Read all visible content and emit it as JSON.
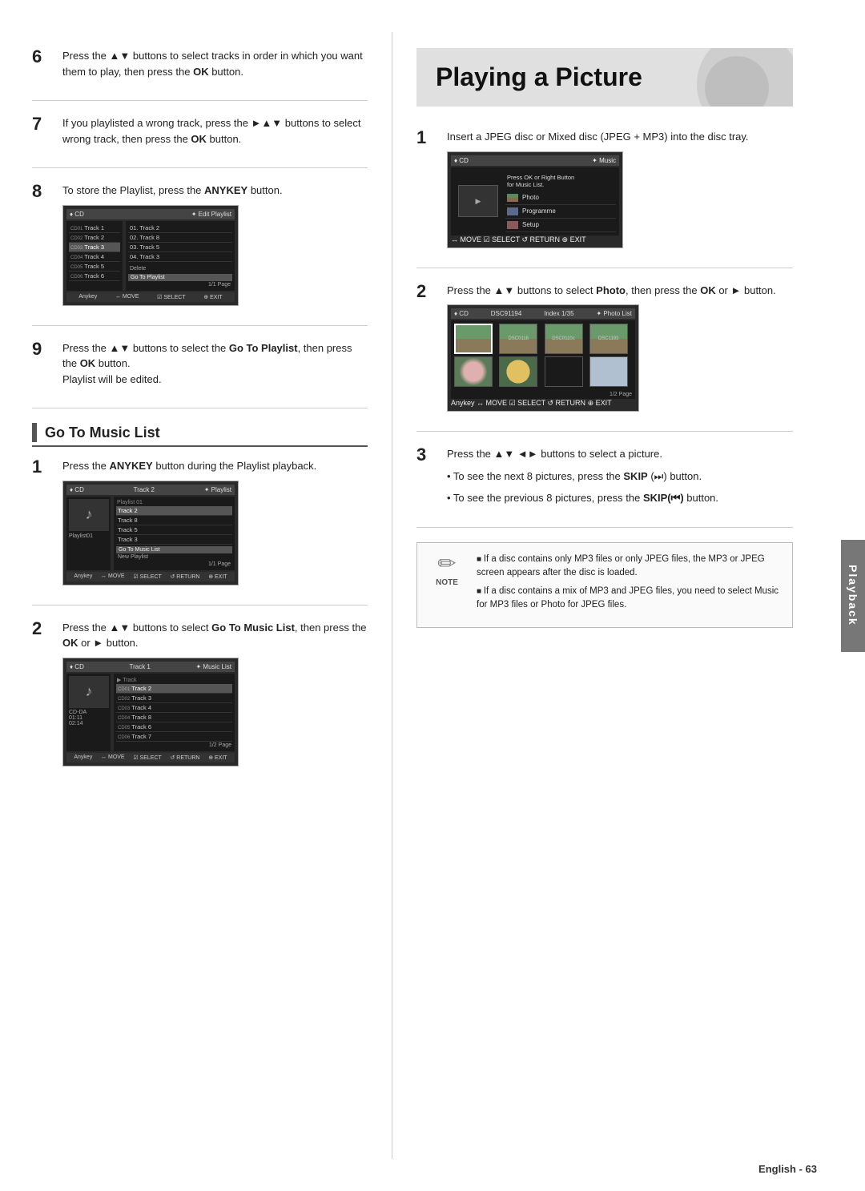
{
  "page": {
    "title": "Playing a Picture",
    "footer": "English - 63",
    "side_tab": "Playback"
  },
  "left_column": {
    "steps": [
      {
        "number": "6",
        "text": "Press the ▲▼ buttons to select tracks in order in which you want them to play, then press the ",
        "bold": "OK",
        "text_after": " button."
      },
      {
        "number": "7",
        "text": "If you playlisted a wrong track, press the ►▲▼ buttons to select wrong track, then press the ",
        "bold": "OK",
        "text_after": " button."
      },
      {
        "number": "8",
        "text": "To store the Playlist, press the ",
        "bold": "ANYKEY",
        "text_after": " button."
      },
      {
        "number": "9",
        "text_before": "Press the ▲▼ buttons to select the ",
        "bold1": "Go To Playlist",
        "text_middle": ", then press the ",
        "bold2": "OK",
        "text_after": " button.\nPlaylist will be edited."
      }
    ],
    "subsection": {
      "title": "Go To Music List",
      "steps": [
        {
          "number": "1",
          "text": "Press the ",
          "bold": "ANYKEY",
          "text_after": " button during the Playlist playback."
        },
        {
          "number": "2",
          "text": "Press the ▲▼ buttons to select ",
          "bold": "Go To Music List",
          "text_after": ", then press the ",
          "bold2": "OK",
          "text_after2": " or ► button."
        }
      ]
    },
    "screen_edit_playlist": {
      "top_left": "♦ CD",
      "top_title": "✦ Edit Playlist",
      "left_tracks": [
        "Track 1",
        "Track 2",
        "Track 3",
        "Track 4",
        "Track 5",
        "Track 6"
      ],
      "right_tracks": [
        "01. Track 2",
        "02. Track 8",
        "03. Track 5",
        "04. Track 3"
      ],
      "delete_label": "Delete",
      "go_to": "Go To Playlist",
      "bottom": "Anykey ↔ MOVE  ☑ SELECT  ⊕ EXIT"
    },
    "screen_playlist": {
      "top": "✦ Playlist",
      "tracks": [
        "Track 2",
        "Track 8",
        "Track 5",
        "Track 3"
      ],
      "playlist_label": "Playlist01",
      "go_to": "Go To Music List",
      "new_playlist": "New Playlist",
      "page": "1/1 Page",
      "bottom": "Anykey ↔ MOVE  ☑ SELECT  ↺ RETURN  ⊕ EXIT"
    },
    "screen_music_list": {
      "top": "✦ Music List",
      "tracks": [
        "Track 2",
        "Track 3",
        "Track 4",
        "Track 8",
        "Track 6",
        "Track 7"
      ],
      "info": [
        "CD-DA",
        "01:11",
        "02:14"
      ],
      "page": "1/2 Page",
      "bottom": "Anykey ↔ MOVE  ☑ SELECT  ↺ RETURN  ⊕ EXIT"
    }
  },
  "right_column": {
    "steps": [
      {
        "number": "1",
        "text": "Insert a JPEG disc or Mixed disc (JPEG + MP3) into the disc tray."
      },
      {
        "number": "2",
        "text_before": "Press the ▲▼ buttons to select ",
        "bold": "Photo",
        "text_after": ", then press the ",
        "bold2": "OK",
        "text_after2": " or ► button."
      },
      {
        "number": "3",
        "text": "Press the ▲▼ ◄► buttons to select a picture.",
        "bullets": [
          "To see the next 8 pictures, press the SKIP (⏭) button.",
          "To see the previous 8 pictures, press the SKIP(⏮) button."
        ]
      }
    ],
    "note": {
      "label": "NOTE",
      "bullets": [
        "If a disc contains only MP3 files or only JPEG files, the MP3 or JPEG screen appears after the disc is loaded.",
        "If a disc contains a mix of MP3 and JPEG files, you need to select Music for MP3 files or Photo for JPEG files."
      ]
    },
    "screen_music_menu": {
      "top_left": "♦ CD",
      "top_right": "✦ Music",
      "note_text": "Press OK or Right Button for Music List.",
      "menu_items": [
        "Photo",
        "Programme",
        "Setup"
      ]
    },
    "screen_photo_list": {
      "top_left": "♦ CD",
      "top_right": "✦ Photo List",
      "filename": "DSC91194",
      "index": "Index 1/35",
      "page": "1/2 Page",
      "bottom": "Anykey ↔ MOVE  ☑ SELECT  ↺ RETURN  ⊕ EXIT"
    }
  }
}
